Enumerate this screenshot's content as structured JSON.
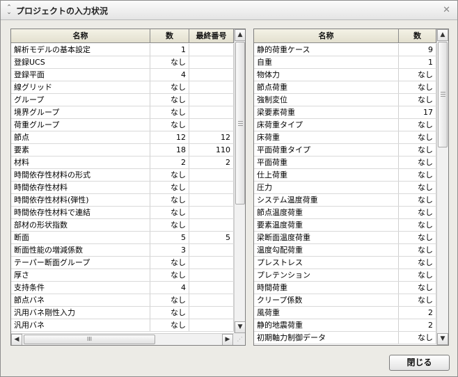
{
  "window": {
    "title": "プロジェクトの入力状況",
    "title_icon": "collapse-icon",
    "close_glyph": "✕"
  },
  "left_table": {
    "headers": [
      "名称",
      "数",
      "最終番号"
    ],
    "rows": [
      [
        "解析モデルの基本設定",
        "1",
        ""
      ],
      [
        "登録UCS",
        "なし",
        ""
      ],
      [
        "登録平面",
        "4",
        ""
      ],
      [
        "線グリッド",
        "なし",
        ""
      ],
      [
        "グループ",
        "なし",
        ""
      ],
      [
        "境界グループ",
        "なし",
        ""
      ],
      [
        "荷重グループ",
        "なし",
        ""
      ],
      [
        "節点",
        "12",
        "12"
      ],
      [
        "要素",
        "18",
        "110"
      ],
      [
        "材料",
        "2",
        "2"
      ],
      [
        "時間依存性材料の形式",
        "なし",
        ""
      ],
      [
        "時間依存性材料",
        "なし",
        ""
      ],
      [
        "時間依存性材料(弾性)",
        "なし",
        ""
      ],
      [
        "時間依存性材料で連結",
        "なし",
        ""
      ],
      [
        "部材の形状指数",
        "なし",
        ""
      ],
      [
        "断面",
        "5",
        "5"
      ],
      [
        "断面性能の増減係数",
        "3",
        ""
      ],
      [
        "テーパー断面グループ",
        "なし",
        ""
      ],
      [
        "厚さ",
        "なし",
        ""
      ],
      [
        "支持条件",
        "4",
        ""
      ],
      [
        "節点バネ",
        "なし",
        ""
      ],
      [
        "汎用バネ剛性入力",
        "なし",
        ""
      ],
      [
        "汎用バネ",
        "なし",
        ""
      ]
    ]
  },
  "right_table": {
    "headers": [
      "名称",
      "数"
    ],
    "rows": [
      [
        "静的荷重ケース",
        "9"
      ],
      [
        "自重",
        "1"
      ],
      [
        "物体力",
        "なし"
      ],
      [
        "節点荷重",
        "なし"
      ],
      [
        "強制変位",
        "なし"
      ],
      [
        "梁要素荷重",
        "17"
      ],
      [
        "床荷重タイプ",
        "なし"
      ],
      [
        "床荷重",
        "なし"
      ],
      [
        "平面荷重タイプ",
        "なし"
      ],
      [
        "平面荷重",
        "なし"
      ],
      [
        "仕上荷重",
        "なし"
      ],
      [
        "圧力",
        "なし"
      ],
      [
        "システム温度荷重",
        "なし"
      ],
      [
        "節点温度荷重",
        "なし"
      ],
      [
        "要素温度荷重",
        "なし"
      ],
      [
        "梁断面温度荷重",
        "なし"
      ],
      [
        "温度勾配荷重",
        "なし"
      ],
      [
        "プレストレス",
        "なし"
      ],
      [
        "プレテンション",
        "なし"
      ],
      [
        "時間荷重",
        "なし"
      ],
      [
        "クリープ係数",
        "なし"
      ],
      [
        "風荷重",
        "2"
      ],
      [
        "静的地震荷重",
        "2"
      ],
      [
        "初期軸力制御データ",
        "なし"
      ]
    ]
  },
  "scrollbar": {
    "up": "▲",
    "down": "▼",
    "left": "◀",
    "right": "▶",
    "thumb_grip": "≡",
    "hthumb_grip": "III",
    "corner_grip": "⋰"
  },
  "buttons": {
    "close_label": "閉じる"
  }
}
